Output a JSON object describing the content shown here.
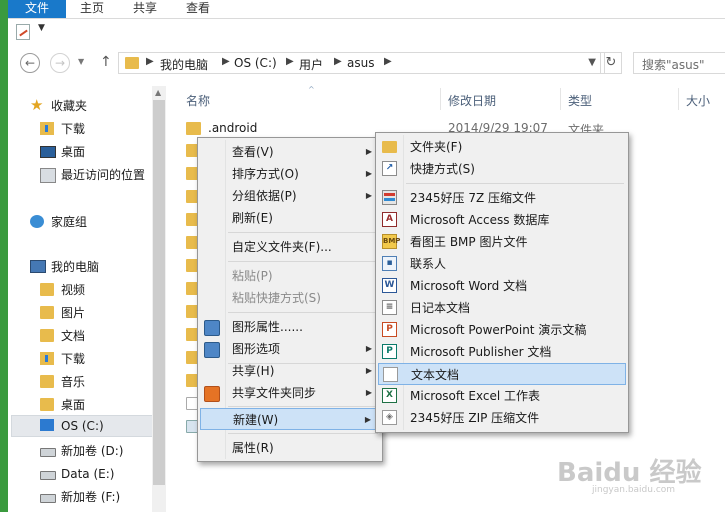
{
  "ribbon": {
    "tabs": [
      "文件",
      "主页",
      "共享",
      "查看"
    ]
  },
  "address": {
    "crumbs": [
      "我的电脑",
      "OS (C:)",
      "用户",
      "asus"
    ]
  },
  "search": {
    "placeholder": "搜索\"asus\""
  },
  "nav": {
    "favorites": "收藏夹",
    "fav_items": [
      "下载",
      "桌面",
      "最近访问的位置"
    ],
    "homegroup": "家庭组",
    "computer": "我的电脑",
    "pc_items": [
      "视频",
      "图片",
      "文档",
      "下载",
      "音乐",
      "桌面"
    ],
    "drives": [
      "OS (C:)",
      "新加卷 (D:)",
      "Data (E:)",
      "新加卷 (F:)"
    ]
  },
  "columns": {
    "name": "名称",
    "date": "修改日期",
    "type": "类型",
    "size": "大小"
  },
  "files": [
    {
      "name": ".android",
      "date": "2014/9/29 19:07",
      "type": "文件夹"
    }
  ],
  "context_menu": {
    "view": "查看(V)",
    "sort": "排序方式(O)",
    "group": "分组依据(P)",
    "refresh": "刷新(E)",
    "customize": "自定义文件夹(F)...",
    "paste": "粘贴(P)",
    "paste_shortcut": "粘贴快捷方式(S)",
    "graphics_props": "图形属性......",
    "graphics_opts": "图形选项",
    "share": "共享(H)",
    "share_sync": "共享文件夹同步",
    "new": "新建(W)",
    "properties": "属性(R)"
  },
  "submenu": {
    "folder": "文件夹(F)",
    "shortcut": "快捷方式(S)",
    "zip7z": "2345好压 7Z 压缩文件",
    "access": "Microsoft Access 数据库",
    "bmp": "看图王 BMP 图片文件",
    "contact": "联系人",
    "word": "Microsoft Word 文档",
    "journal": "日记本文档",
    "ppt": "Microsoft PowerPoint 演示文稿",
    "publisher": "Microsoft Publisher 文档",
    "txt": "文本文档",
    "excel": "Microsoft Excel 工作表",
    "zip": "2345好压 ZIP 压缩文件"
  },
  "watermark": {
    "brand": "Baidu 经验",
    "url": "jingyan.baidu.com"
  }
}
